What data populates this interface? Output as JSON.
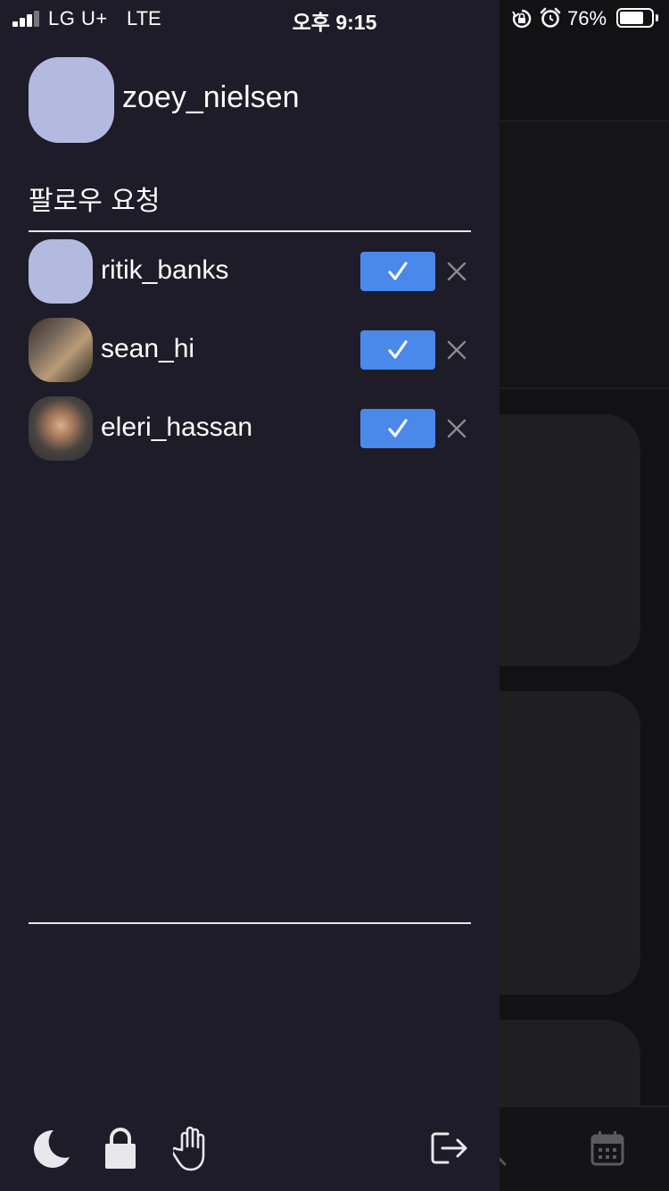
{
  "status_bar": {
    "carrier": "LG U+",
    "network": "LTE",
    "time": "오후 9:15",
    "battery": "76%",
    "icons": [
      "signal-icon",
      "orientation-lock-icon",
      "alarm-icon",
      "battery-icon"
    ]
  },
  "profile": {
    "username": "zoey_nielsen"
  },
  "follow_requests": {
    "title": "팔로우 요청",
    "items": [
      {
        "username": "ritik_banks",
        "avatar": "default"
      },
      {
        "username": "sean_hi",
        "avatar": "photo"
      },
      {
        "username": "eleri_hassan",
        "avatar": "photo"
      }
    ]
  },
  "bottom_bar": {
    "icons": [
      "moon-icon",
      "lock-icon",
      "hand-icon",
      "logout-icon"
    ]
  },
  "background_tabbar": {
    "icons": [
      "search-icon",
      "calendar-icon"
    ]
  },
  "colors": {
    "drawer_bg": "#1e1c28",
    "accent": "#4a88ea",
    "avatar_default": "#b4b9e0",
    "background": "#121214"
  }
}
